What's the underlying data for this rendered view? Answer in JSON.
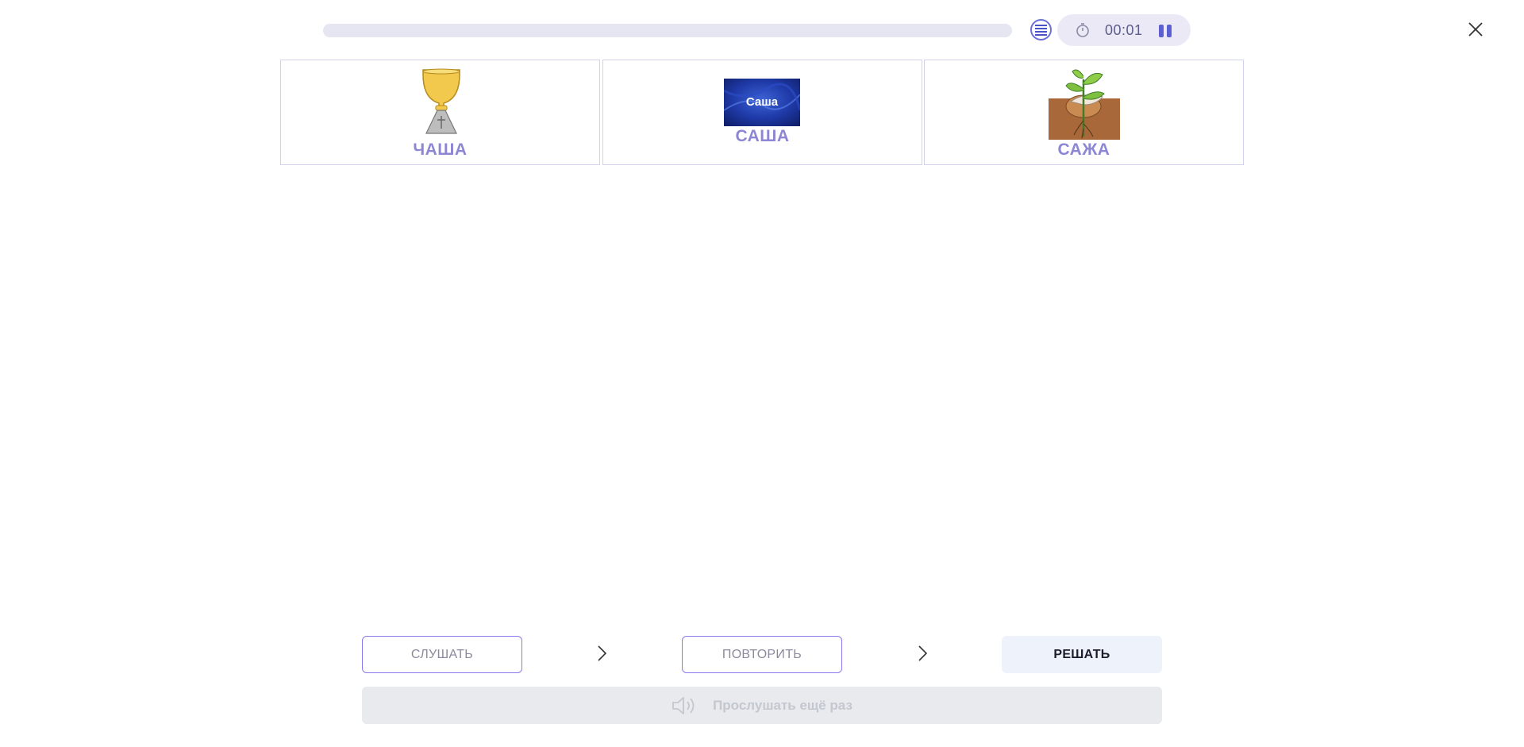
{
  "header": {
    "progress_fraction": 0,
    "timer": "00:01",
    "icons": {
      "list": "list-icon",
      "timer": "stopwatch-icon",
      "pause": "pause-icon",
      "close": "close-icon"
    }
  },
  "cards": [
    {
      "label": "ЧАША",
      "image": "chalice-image"
    },
    {
      "label": "САША",
      "image": "name-card-image",
      "image_text": "Саша"
    },
    {
      "label": "САЖА",
      "image": "seedling-in-soil-image"
    }
  ],
  "steps": {
    "listen": "СЛУШАТЬ",
    "repeat": "ПОВТОРИТЬ",
    "solve": "РЕШАТЬ"
  },
  "listen_again": {
    "label": "Прослушать ещё раз",
    "icon": "speaker-icon"
  },
  "colors": {
    "accent": "#8c86d4",
    "primary": "#5c5fd2",
    "outline": "#8a78ee"
  }
}
